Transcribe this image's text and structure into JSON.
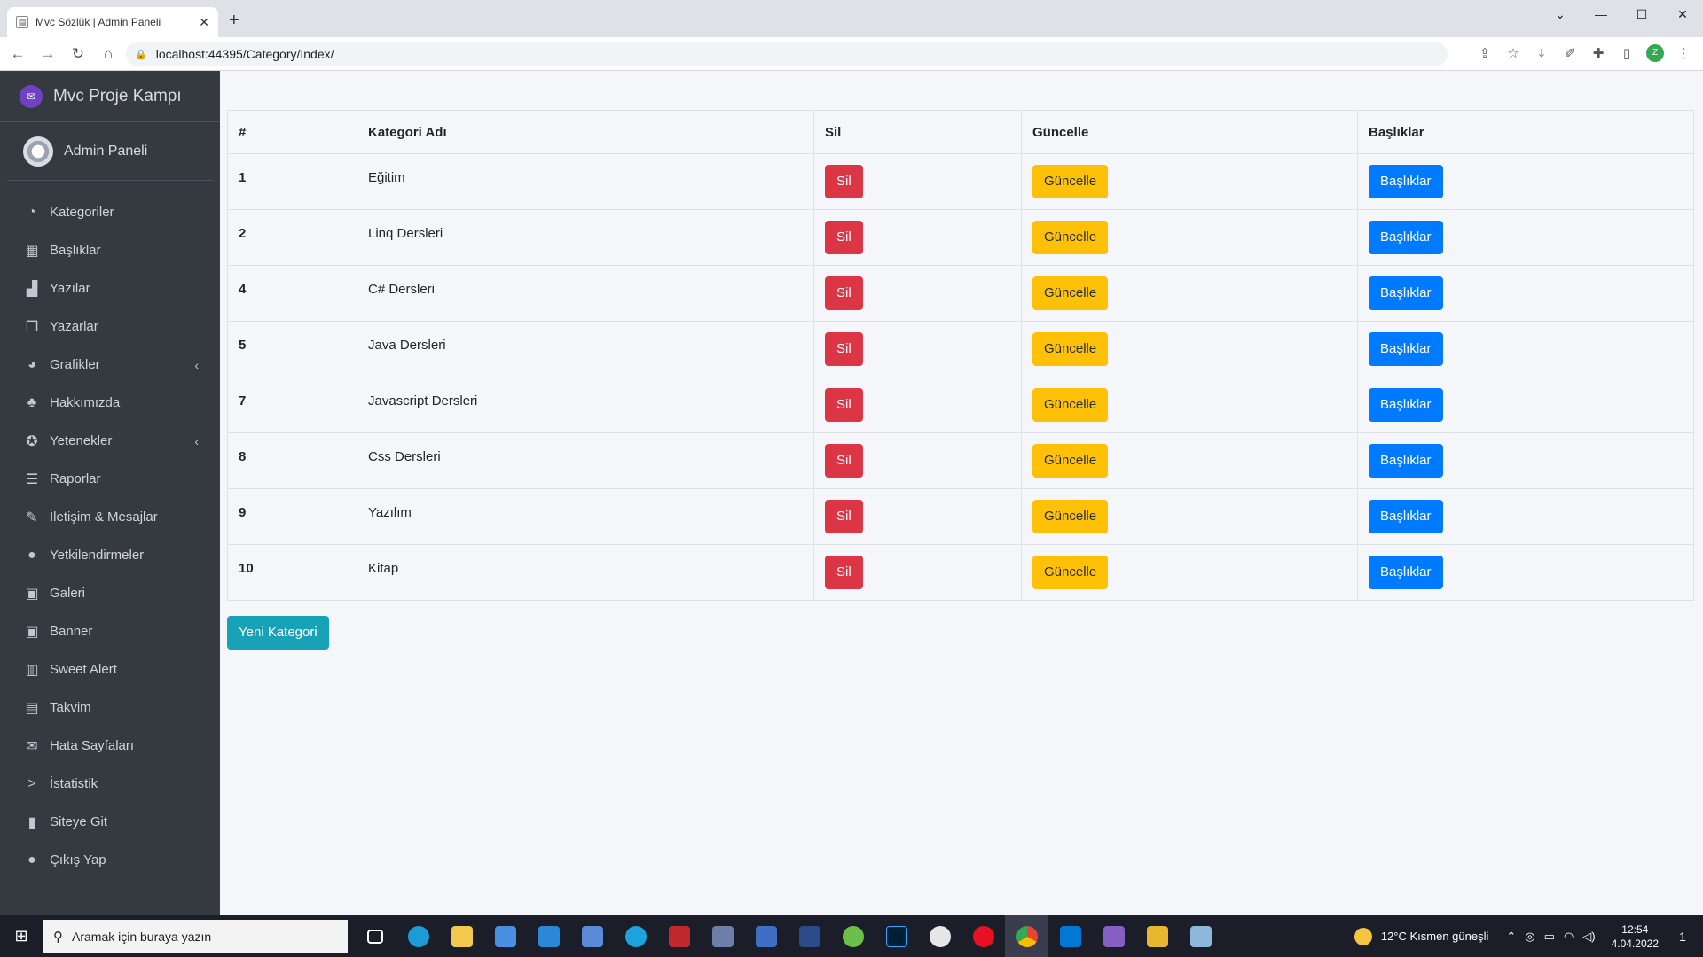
{
  "browser": {
    "tab_title": "Mvc Sözlük | Admin Paneli",
    "tab_close": "✕",
    "new_tab": "+",
    "url": "localhost:44395/Category/Index/"
  },
  "sidebar": {
    "brand": "Mvc Proje Kampı",
    "user": "Admin Paneli",
    "items": [
      {
        "label": "Kategoriler",
        "icon": "dashboard-icon",
        "glyph": "◔"
      },
      {
        "label": "Başlıklar",
        "icon": "grid-icon",
        "glyph": "▦"
      },
      {
        "label": "Yazılar",
        "icon": "user-tie-icon",
        "glyph": "▟"
      },
      {
        "label": "Yazarlar",
        "icon": "copy-icon",
        "glyph": "❐"
      },
      {
        "label": "Grafikler",
        "icon": "pie-chart-icon",
        "glyph": "◕",
        "chevron": "‹"
      },
      {
        "label": "Hakkımızda",
        "icon": "bell-icon",
        "glyph": "♣"
      },
      {
        "label": "Yetenekler",
        "icon": "award-icon",
        "glyph": "✪",
        "chevron": "‹"
      },
      {
        "label": "Raporlar",
        "icon": "bars-icon",
        "glyph": "☰"
      },
      {
        "label": "İletişim & Mesajlar",
        "icon": "edit-icon",
        "glyph": "✎"
      },
      {
        "label": "Yetkilendirmeler",
        "icon": "user-circle-icon",
        "glyph": "●"
      },
      {
        "label": "Galeri",
        "icon": "image-icon",
        "glyph": "▣"
      },
      {
        "label": "Banner",
        "icon": "image-icon",
        "glyph": "▣"
      },
      {
        "label": "Sweet Alert",
        "icon": "map-icon",
        "glyph": "▥"
      },
      {
        "label": "Takvim",
        "icon": "calendar-icon",
        "glyph": "▤"
      },
      {
        "label": "Hata Sayfaları",
        "icon": "envelope-icon",
        "glyph": "✉"
      },
      {
        "label": "İstatistik",
        "icon": "chevron-right-icon",
        "glyph": ">"
      },
      {
        "label": "Siteye Git",
        "icon": "book-icon",
        "glyph": "▮"
      },
      {
        "label": "Çıkış Yap",
        "icon": "apple-icon",
        "glyph": "●"
      }
    ]
  },
  "table": {
    "headers": [
      "#",
      "Kategori Adı",
      "Sil",
      "Güncelle",
      "Başlıklar"
    ],
    "rows": [
      {
        "id": "1",
        "name": "Eğitim"
      },
      {
        "id": "2",
        "name": "Linq Dersleri"
      },
      {
        "id": "4",
        "name": "C# Dersleri"
      },
      {
        "id": "5",
        "name": "Java Dersleri"
      },
      {
        "id": "7",
        "name": "Javascript Dersleri"
      },
      {
        "id": "8",
        "name": "Css Dersleri"
      },
      {
        "id": "9",
        "name": "Yazılım"
      },
      {
        "id": "10",
        "name": "Kitap"
      }
    ],
    "delete_label": "Sil",
    "update_label": "Güncelle",
    "titles_label": "Başlıklar"
  },
  "new_category_label": "Yeni Kategori",
  "taskbar": {
    "search_placeholder": "Aramak için buraya yazın",
    "weather": "12°C  Kısmen güneşli",
    "time": "12:54",
    "date": "4.04.2022",
    "notifications": "1"
  },
  "colors": {
    "sidebar_bg": "#343a40",
    "danger": "#dc3545",
    "warning": "#ffc107",
    "primary": "#007bff",
    "info": "#17a2b8"
  }
}
